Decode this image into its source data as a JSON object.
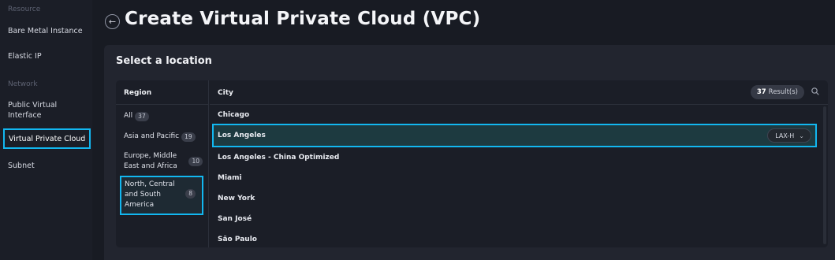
{
  "sidebar": {
    "section_resource": "Resource",
    "items_resource": [
      {
        "label": "Bare Metal Instance"
      },
      {
        "label": "Elastic IP"
      }
    ],
    "section_network": "Network",
    "items_network": [
      {
        "label": "Public Virtual Interface"
      },
      {
        "label": "Virtual Private Cloud"
      },
      {
        "label": "Subnet"
      }
    ]
  },
  "header": {
    "back_icon": "arrow-left-icon",
    "title": "Create Virtual Private Cloud (VPC)"
  },
  "location": {
    "title": "Select a location",
    "region_header": "Region",
    "city_header": "City",
    "result_count": "37",
    "result_label": "Result(s)",
    "search_icon": "search-icon",
    "regions": [
      {
        "label": "All",
        "count": "37"
      },
      {
        "label": "Asia and Pacific",
        "count": "19"
      },
      {
        "label": "Europe, Middle East and Africa",
        "count": "10"
      },
      {
        "label": "North, Central and South America",
        "count": "8",
        "selected": true
      }
    ],
    "cities": [
      {
        "label": "Chicago"
      },
      {
        "label": "Los Angeles",
        "selected": true,
        "datacenter": "LAX-H"
      },
      {
        "label": "Los Angeles - China Optimized"
      },
      {
        "label": "Miami"
      },
      {
        "label": "New York"
      },
      {
        "label": "San José"
      },
      {
        "label": "São Paulo"
      }
    ]
  },
  "colors": {
    "accent": "#12b7f0",
    "background": "#181b23",
    "panel": "#22252f",
    "selected_row": "#1d3a40"
  }
}
